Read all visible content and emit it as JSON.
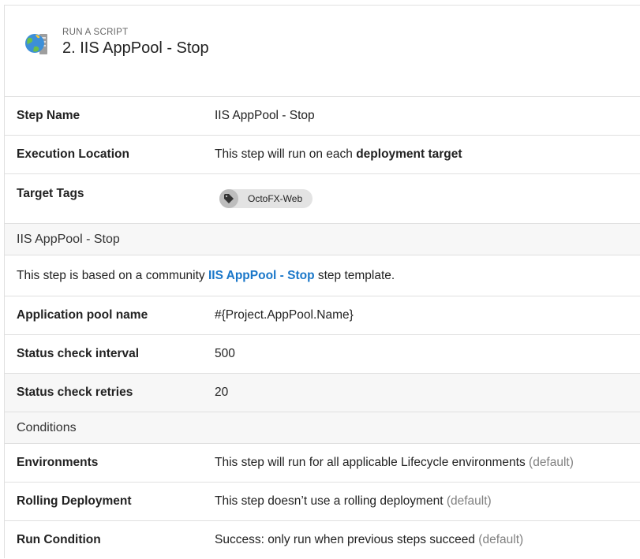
{
  "header": {
    "step_type": "RUN A SCRIPT",
    "title": "2. IIS AppPool - Stop",
    "icon": "globe-server-icon"
  },
  "properties": [
    {
      "label": "Step Name",
      "value": "IIS AppPool - Stop"
    },
    {
      "label": "Execution Location",
      "value_prefix": "This step will run on each ",
      "value_bold": "deployment target"
    },
    {
      "label": "Target Tags",
      "tag": "OctoFX-Web",
      "tag_icon": "tag-icon"
    }
  ],
  "template_section": {
    "title": "IIS AppPool - Stop",
    "note_prefix": "This step is based on a community ",
    "note_link": "IIS AppPool - Stop",
    "note_suffix": " step template.",
    "parameters": [
      {
        "label": "Application pool name",
        "value": "#{Project.AppPool.Name}"
      },
      {
        "label": "Status check interval",
        "value": "500"
      },
      {
        "label": "Status check retries",
        "value": "20"
      }
    ]
  },
  "conditions": {
    "title": "Conditions",
    "items": [
      {
        "label": "Environments",
        "value": "This step will run for all applicable Lifecycle environments",
        "suffix": "(default)"
      },
      {
        "label": "Rolling Deployment",
        "value": "This step doesn’t use a rolling deployment",
        "suffix": "(default)"
      },
      {
        "label": "Run Condition",
        "value": "Success: only run when previous steps succeed",
        "suffix": "(default)"
      }
    ]
  },
  "colors": {
    "link": "#1a77c9",
    "default_text": "#808080",
    "border": "#e0e0e0",
    "shaded_row": "#f7f7f7"
  }
}
